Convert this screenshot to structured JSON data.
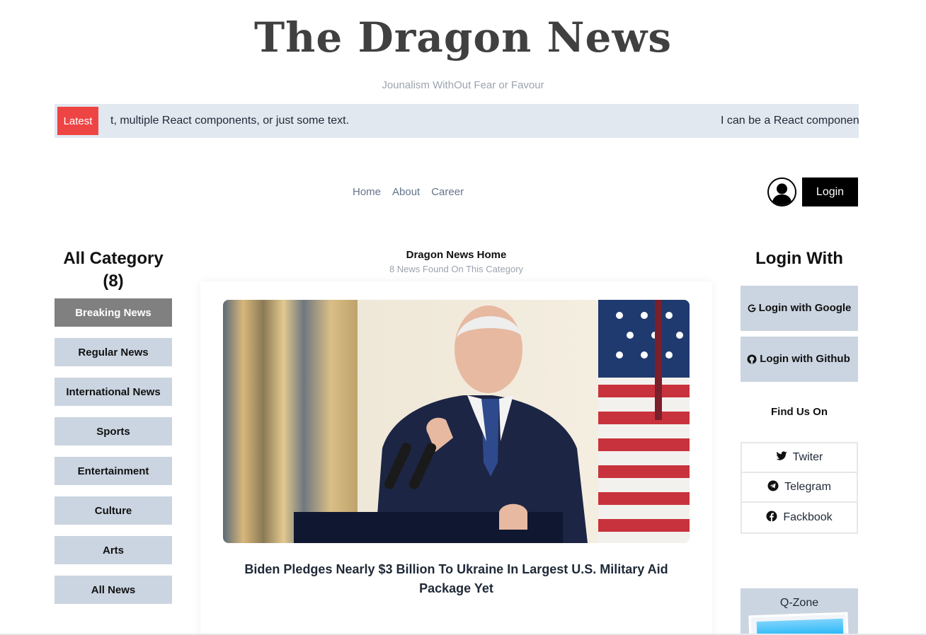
{
  "header": {
    "brand": "The Dragon News",
    "tagline": "Jounalism WithOut Fear or Favour"
  },
  "ticker": {
    "badge": "Latest",
    "message_a": "t, multiple React components, or just some text.",
    "message_b": "I can be a React componen"
  },
  "nav": {
    "items": [
      "Home",
      "About",
      "Career"
    ],
    "login_label": "Login"
  },
  "left": {
    "heading": "All Category (8)",
    "categories": [
      {
        "label": "Breaking News",
        "active": true
      },
      {
        "label": "Regular News",
        "active": false
      },
      {
        "label": "International News",
        "active": false
      },
      {
        "label": "Sports",
        "active": false
      },
      {
        "label": "Entertainment",
        "active": false
      },
      {
        "label": "Culture",
        "active": false
      },
      {
        "label": "Arts",
        "active": false
      },
      {
        "label": "All News",
        "active": false
      }
    ]
  },
  "main": {
    "title": "Dragon News Home",
    "subtitle": "8 News Found On This Category",
    "article": {
      "headline": "Biden Pledges Nearly $3 Billion To Ukraine In Largest U.S. Military Aid Package Yet"
    }
  },
  "right": {
    "heading": "Login With",
    "login_google": "Login with Google",
    "login_github": "Login with Github",
    "find_heading": "Find Us On",
    "socials": [
      {
        "label": "Twiter",
        "icon": "twitter-icon"
      },
      {
        "label": "Telegram",
        "icon": "telegram-icon"
      },
      {
        "label": "Fackbook",
        "icon": "facebook-icon"
      }
    ],
    "qzone_title": "Q-Zone"
  },
  "colors": {
    "accent_red": "#ef4444",
    "category_bg": "#cbd5e1",
    "category_active_bg": "#808080",
    "ticker_bg": "#e2e8f0"
  }
}
